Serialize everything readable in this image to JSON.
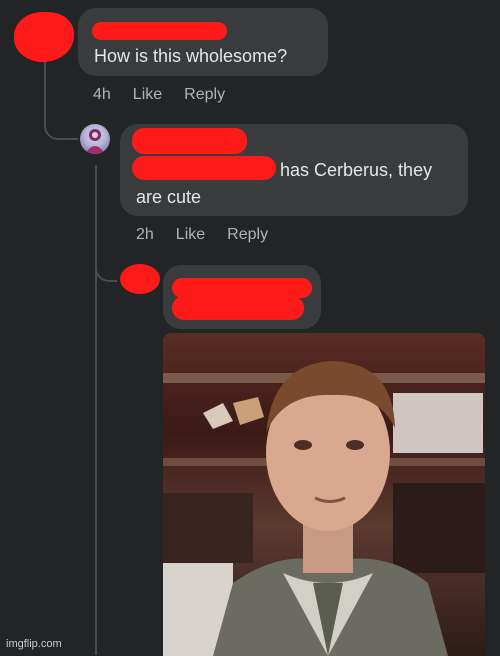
{
  "comment1": {
    "text": "How is this wholesome?",
    "time": "4h",
    "like": "Like",
    "reply": "Reply"
  },
  "comment2": {
    "text_line1": "has Cerberus, they",
    "text_line2": "are cute",
    "time": "2h",
    "like": "Like",
    "reply": "Reply"
  },
  "watermark": "imgflip.com",
  "colors": {
    "background": "#222426",
    "bubble": "#3a3b3d",
    "redaction": "#ff1a1a",
    "meta_text": "#b0b3b8"
  }
}
